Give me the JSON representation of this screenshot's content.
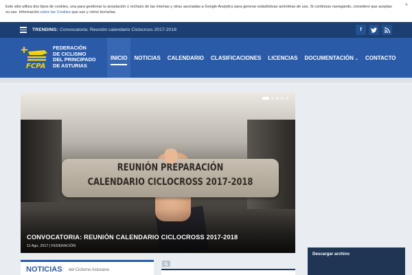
{
  "cookie": {
    "text_1": "Este sitio utiliza dos tipos de cookies, una para gestionar tu aceptación o rechazo de las mismas y otras asociadas a Google Analytics para generar estadísticas anónimas de uso. Si continúas navegando, considero que aceptas su uso. Información ",
    "link": "sobre las Cookies",
    "text_2": " que uso y cómo borrarlas.",
    "close": "×"
  },
  "topbar": {
    "trending_label": "TRENDING:",
    "trending_text": "Convocatoria: Reunión calendario Ciclocross 2017-2018",
    "social": [
      {
        "icon": "facebook-icon",
        "glyph": "f"
      },
      {
        "icon": "twitter-icon",
        "glyph": "t"
      },
      {
        "icon": "rss-icon",
        "glyph": "r"
      }
    ]
  },
  "header": {
    "logo_text": "FCPA",
    "brand": [
      "FEDERACIÓN",
      "DE CICLISMO",
      "DEL PRINCIPADO",
      "DE ASTURIAS"
    ],
    "nav": [
      "INICIO",
      "NOTICIAS",
      "CALENDARIO",
      "CLASIFICACIONES",
      "LICENCIAS",
      "DOCUMENTACIÓN",
      "CONTACTO"
    ],
    "active_index": 0,
    "nav_dropdown_index": 5
  },
  "hero": {
    "card_line_1": "REUNIÓN PREPARACIÓN",
    "card_line_2": "CALENDARIO CICLOCROSS 2017-2018",
    "title": "CONVOCATORIA: REUNIÓN CALENDARIO CICLOCROSS 2017-2018",
    "date": "11 Ago, 2017",
    "category": "FEDERACIÓN",
    "slides": 5,
    "active_slide": 0
  },
  "sidebar": {
    "archive_title": "Descargar archivo"
  },
  "widgets": {
    "noticias_title": "NOTICIAS",
    "noticias_sub": "del Ciclismo Asturiano"
  },
  "colors": {
    "brand_blue": "#2a5ba8",
    "dark_blue": "#1b3f73",
    "logo_yellow": "#f5d400"
  }
}
